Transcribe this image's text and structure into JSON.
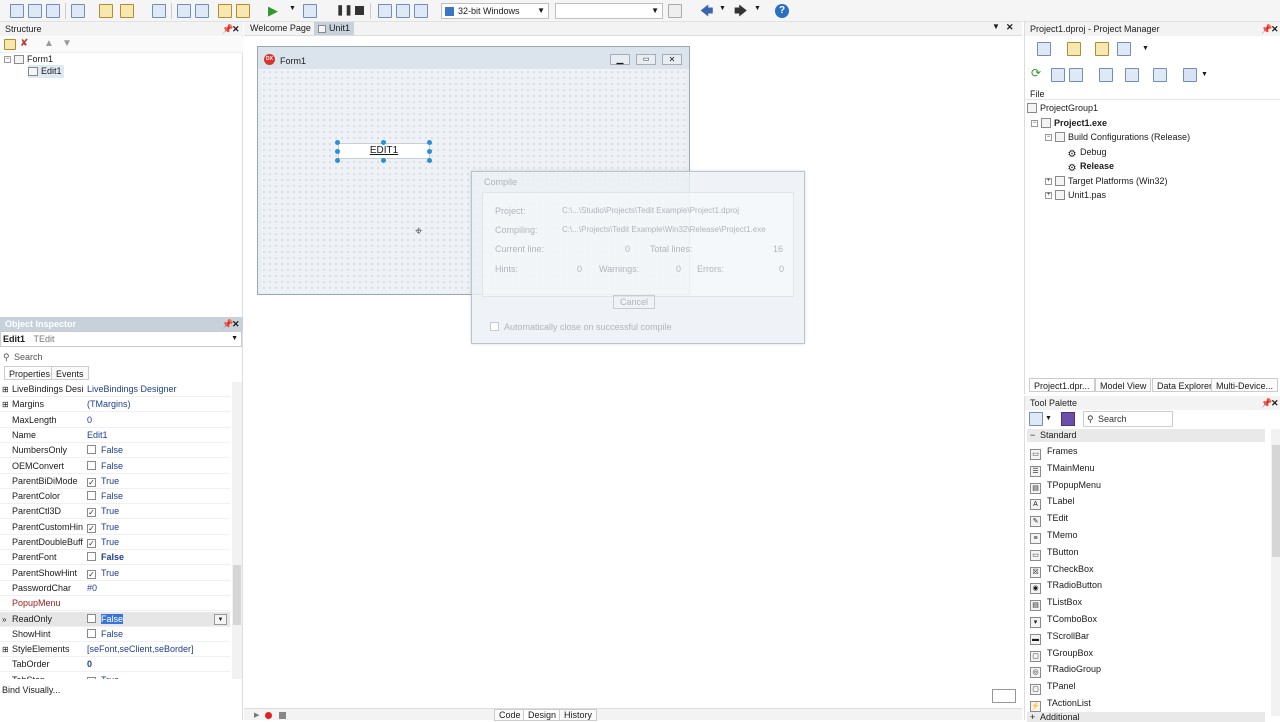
{
  "toolbar": {
    "platform_label": "32-bit Windows",
    "config_value": "",
    "help_label": "?"
  },
  "structure": {
    "title": "Structure",
    "items": [
      {
        "label": "Form1"
      },
      {
        "label": "Edit1"
      }
    ]
  },
  "editor_tabs": {
    "welcome": "Welcome Page",
    "unit": "Unit1"
  },
  "form": {
    "caption": "Form1",
    "edit_text": "EDIT1"
  },
  "compile": {
    "title": "Compile",
    "project_label": "Project:",
    "project_value": "C:\\...\\Studio\\Projects\\Tedit Example\\Project1.dproj",
    "compiling_label": "Compiling:",
    "compiling_value": "C:\\...\\Projects\\Tedit Example\\Win32\\Release\\Project1.exe",
    "current_line_label": "Current line:",
    "current_line_value": "0",
    "total_lines_label": "Total lines:",
    "total_lines_value": "16",
    "hints_label": "Hints:",
    "hints_value": "0",
    "warnings_label": "Warnings:",
    "warnings_value": "0",
    "errors_label": "Errors:",
    "errors_value": "0",
    "cancel_label": "Cancel",
    "autoclose_label": "Automatically close on successful compile"
  },
  "object_inspector": {
    "title": "Object Inspector",
    "selected_name": "Edit1",
    "selected_type": "TEdit",
    "search_placeholder": "Search",
    "tab_properties": "Properties",
    "tab_events": "Events",
    "rows": [
      {
        "name": "LiveBindings Desi",
        "value": "LiveBindings Designer",
        "check": "",
        "expand": "+"
      },
      {
        "name": "Margins",
        "value": "(TMargins)",
        "check": "",
        "expand": "+"
      },
      {
        "name": "MaxLength",
        "value": "0",
        "check": "",
        "expand": ""
      },
      {
        "name": "Name",
        "value": "Edit1",
        "check": "",
        "expand": ""
      },
      {
        "name": "NumbersOnly",
        "value": "False",
        "check": "off",
        "expand": ""
      },
      {
        "name": "OEMConvert",
        "value": "False",
        "check": "off",
        "expand": ""
      },
      {
        "name": "ParentBiDiMode",
        "value": "True",
        "check": "on",
        "expand": ""
      },
      {
        "name": "ParentColor",
        "value": "False",
        "check": "off",
        "expand": ""
      },
      {
        "name": "ParentCtl3D",
        "value": "True",
        "check": "on",
        "expand": ""
      },
      {
        "name": "ParentCustomHin",
        "value": "True",
        "check": "on",
        "expand": ""
      },
      {
        "name": "ParentDoubleBuff",
        "value": "True",
        "check": "on",
        "expand": ""
      },
      {
        "name": "ParentFont",
        "value": "False",
        "check": "off",
        "expand": ""
      },
      {
        "name": "ParentShowHint",
        "value": "True",
        "check": "on",
        "expand": ""
      },
      {
        "name": "PasswordChar",
        "value": "#0",
        "check": "",
        "expand": ""
      },
      {
        "name": "PopupMenu",
        "value": "",
        "check": "",
        "expand": ""
      },
      {
        "name": "ReadOnly",
        "value": "False",
        "check": "off",
        "expand": ">>"
      },
      {
        "name": "ShowHint",
        "value": "False",
        "check": "off",
        "expand": ""
      },
      {
        "name": "StyleElements",
        "value": "[seFont,seClient,seBorder]",
        "check": "",
        "expand": "+"
      },
      {
        "name": "TabOrder",
        "value": "0",
        "check": "",
        "expand": ""
      },
      {
        "name": "TabStop",
        "value": "True",
        "check": "on",
        "expand": ""
      }
    ],
    "bind_visually": "Bind Visually..."
  },
  "project_manager": {
    "title": "Project1.dproj - Project Manager",
    "file_label": "File",
    "tree": [
      {
        "label": "ProjectGroup1",
        "bold": false
      },
      {
        "label": "Project1.exe",
        "bold": true
      },
      {
        "label": "Build Configurations (Release)",
        "bold": false
      },
      {
        "label": "Debug",
        "bold": false
      },
      {
        "label": "Release",
        "bold": true
      },
      {
        "label": "Target Platforms (Win32)",
        "bold": false
      },
      {
        "label": "Unit1.pas",
        "bold": false
      }
    ],
    "tabs": [
      "Project1.dpr...",
      "Model View",
      "Data Explorer",
      "Multi-Device..."
    ]
  },
  "tool_palette": {
    "title": "Tool Palette",
    "search_placeholder": "Search",
    "category": "Standard",
    "items": [
      "Frames",
      "TMainMenu",
      "TPopupMenu",
      "TLabel",
      "TEdit",
      "TMemo",
      "TButton",
      "TCheckBox",
      "TRadioButton",
      "TListBox",
      "TComboBox",
      "TScrollBar",
      "TGroupBox",
      "TRadioGroup",
      "TPanel",
      "TActionList"
    ],
    "next_category": "Additional"
  },
  "bottom_tabs": {
    "code": "Code",
    "design": "Design",
    "history": "History"
  },
  "colors": {
    "oi_title_bg": "#c7d1dc",
    "accent": "#1f3e91",
    "popup_red": "#a02020",
    "handle_blue": "#2a8fd6"
  }
}
